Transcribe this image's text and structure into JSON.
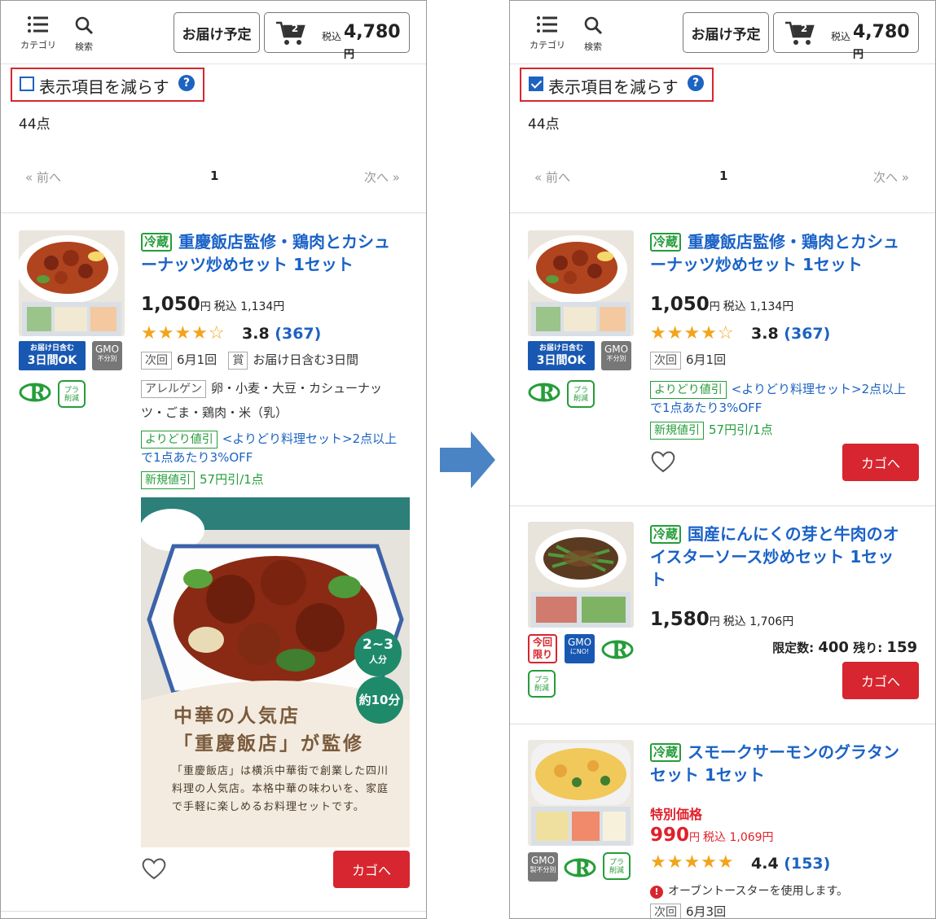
{
  "header": {
    "category_label": "カテゴリ",
    "search_label": "検索",
    "delivery_label": "お届け予定",
    "cart_count": "2",
    "cart_tax_label": "税込",
    "cart_total": "4,780",
    "cart_yen": "円"
  },
  "compact_toggle": {
    "label": "表示項目を減らす",
    "help": "?",
    "left_checked": false,
    "right_checked": true
  },
  "item_count": "44点",
  "pager": {
    "prev": "« 前へ",
    "current": "1",
    "next": "次へ »"
  },
  "cart_button_label": "カゴへ",
  "products": [
    {
      "badge": "冷蔵",
      "title_line1": "重慶飯店監修・鶏肉とカシュ",
      "title_line2": "ーナッツ炒めセット 1セット",
      "price": "1,050",
      "yen": "円",
      "tax_price": "税込 1,134円",
      "stars": "★★★★☆",
      "rating": "3.8",
      "reviews": "(367)",
      "next_label": "次回",
      "next_value": "6月1回",
      "award_label": "賞",
      "award_value": "お届け日含む3日間",
      "allergen_label": "アレルゲン",
      "allergen_line1": "卵・小麦・大豆・カシューナッ",
      "allergen_line2": "ツ・ごま・鶏肉・米（乳）",
      "yoridori_tag": "よりどり値引",
      "yoridori_line1": "<よりどり料理セット>2点以上",
      "yoridori_line2": "で1点あたり3%OFF",
      "new_tag": "新規値引",
      "new_text": "57円引/1点",
      "delivery_badge_small": "お届け日含む",
      "delivery_badge_big": "3日間OK",
      "gmo_top": "GMO",
      "gmo_bottom": "不分別",
      "pla_top": "プラ",
      "pla_bottom": "削減",
      "banner": {
        "title_line1": "中華の人気店",
        "title_line2": "「重慶飯店」が監修",
        "desc": "「重慶飯店」は横浜中華街で創業した四川料理の人気店。本格中華の味わいを、家庭で手軽に楽しめるお料理セットです。",
        "serving_top": "2~3",
        "serving_bottom": "人分",
        "time": "約10分"
      }
    },
    {
      "badge": "冷蔵",
      "title_line1": "国産にんにくの芽と牛肉のオ",
      "title_line2": "イスターソース炒めセット 1セッ",
      "title_line3": "ト",
      "price": "1,580",
      "yen": "円",
      "tax_price": "税込 1,706円",
      "limit_label": "限定数:",
      "limit_value": "400",
      "remain_label": "残り:",
      "remain_value": "159",
      "today_top": "今回",
      "today_bottom": "限り",
      "gmo_top": "GMO",
      "gmo_bottom": "にNO!",
      "pla_top": "プラ",
      "pla_bottom": "削減"
    },
    {
      "badge": "冷蔵",
      "title_line1": "スモークサーモンのグラタン",
      "title_line2": "セット 1セット",
      "special": "特別価格",
      "price": "990",
      "yen": "円",
      "tax_price": "税込 1,069円",
      "stars": "★★★★★",
      "rating": "4.4",
      "reviews": "(153)",
      "notice": "オーブントースターを使用します。",
      "next_label": "次回",
      "next_value": "6月3回",
      "gmo_top": "GMO",
      "gmo_bottom": "製不分別",
      "pla_top": "プラ",
      "pla_bottom": "削減"
    }
  ],
  "colors": {
    "link_blue": "#1a62c7",
    "red": "#d7262f",
    "green": "#259d3a",
    "star": "#f2a41a"
  }
}
